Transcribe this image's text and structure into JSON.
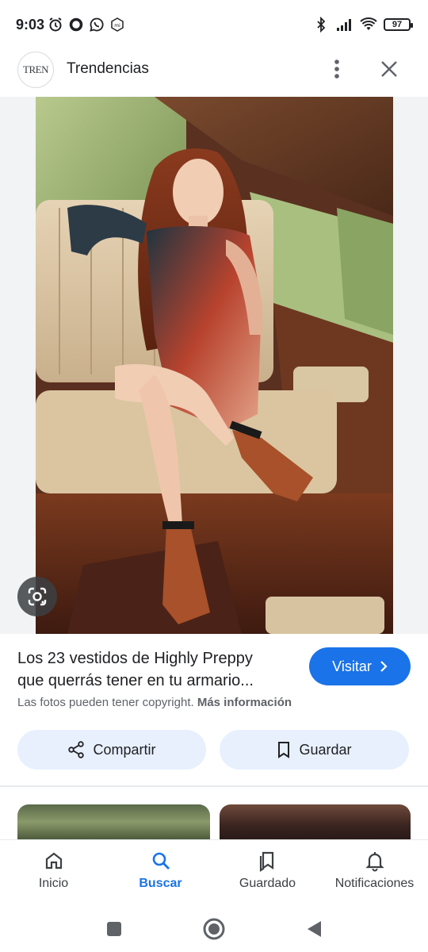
{
  "status_bar": {
    "time": "9:03",
    "battery": "97",
    "left_icons": [
      "alarm-icon",
      "circle-notification-icon",
      "whatsapp-icon",
      "mi-icon"
    ],
    "right_icons": [
      "bluetooth-icon",
      "signal-icon",
      "wifi-icon",
      "battery-icon"
    ]
  },
  "header": {
    "avatar_text": "TREN",
    "title": "Trendencias",
    "more_icon": "more-vert-icon",
    "close_icon": "close-icon"
  },
  "image": {
    "lens_icon": "google-lens-icon"
  },
  "result": {
    "title_line1": "Los 23 vestidos de Highly Preppy",
    "title_line2": "que querrás tener en tu armario...",
    "visit_label": "Visitar",
    "copyright_text": "Las fotos pueden tener copyright.",
    "more_info_label": "Más información",
    "share_label": "Compartir",
    "save_label": "Guardar"
  },
  "bottom_nav": {
    "items": [
      {
        "label": "Inicio",
        "icon": "home-icon",
        "active": false
      },
      {
        "label": "Buscar",
        "icon": "search-icon",
        "active": true
      },
      {
        "label": "Guardado",
        "icon": "bookmarks-icon",
        "active": false
      },
      {
        "label": "Notificaciones",
        "icon": "bell-icon",
        "active": false
      }
    ]
  },
  "colors": {
    "accent": "#1a73e8",
    "chip_bg": "#e8f0fe",
    "text": "#202124",
    "muted": "#5f6368"
  }
}
